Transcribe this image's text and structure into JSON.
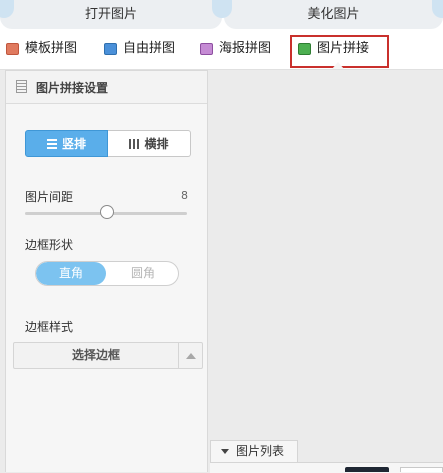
{
  "top_tabs": {
    "open_image": "打开图片",
    "beautify_image": "美化图片"
  },
  "toolbar": {
    "items": [
      {
        "label": "模板拼图",
        "icon": "template-collage-icon",
        "color": "#e07a5f"
      },
      {
        "label": "自由拼图",
        "icon": "free-collage-icon",
        "color": "#4a90d9"
      },
      {
        "label": "海报拼图",
        "icon": "poster-collage-icon",
        "color": "#a35bb5"
      },
      {
        "label": "图片拼接",
        "icon": "image-splice-icon",
        "color": "#4caf50"
      }
    ],
    "selected_index": 3
  },
  "panel": {
    "title": "图片拼接设置",
    "orientation": {
      "vertical_label": "竖排",
      "horizontal_label": "横排",
      "selected": "vertical"
    },
    "spacing": {
      "label": "图片间距",
      "value": "8"
    },
    "border_shape": {
      "label": "边框形状",
      "square_label": "直角",
      "round_label": "圆角",
      "selected": "square"
    },
    "border_style": {
      "label": "边框样式",
      "select_label": "选择边框"
    }
  },
  "image_list": {
    "tab_label": "图片列表"
  },
  "colors": {
    "accent": "#5aaeea",
    "selection_outline": "#c9302c"
  }
}
